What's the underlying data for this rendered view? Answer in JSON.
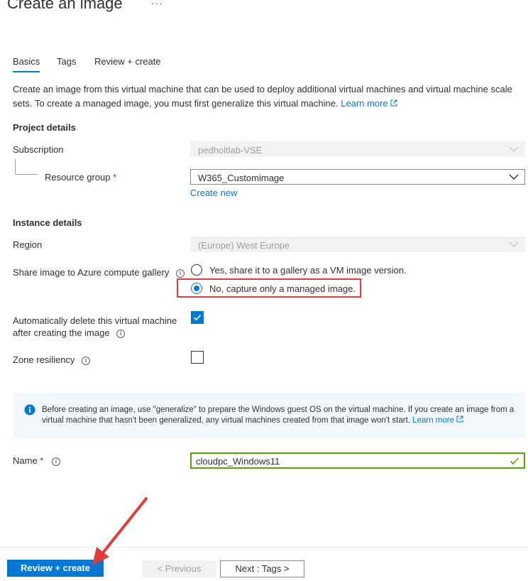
{
  "header": {
    "title": "Create an image",
    "more": "···"
  },
  "tabs": [
    {
      "label": "Basics"
    },
    {
      "label": "Tags"
    },
    {
      "label": "Review + create"
    }
  ],
  "description": {
    "text": "Create an image from this virtual machine that can be used to deploy additional virtual machines and virtual machine scale sets. To create a managed image, you must first generalize this virtual machine.",
    "link": "Learn more"
  },
  "project": {
    "heading": "Project details",
    "subscription": {
      "label": "Subscription",
      "value": "pedholtlab-VSE"
    },
    "resource_group": {
      "label": "Resource group",
      "required": "*",
      "value": "W365_Customimage",
      "create_new": "Create new"
    }
  },
  "instance": {
    "heading": "Instance details",
    "region": {
      "label": "Region",
      "value": "(Europe) West Europe"
    },
    "share": {
      "label": "Share image to Azure compute gallery",
      "options": [
        {
          "label": "Yes, share it to a gallery as a VM image version.",
          "selected": false
        },
        {
          "label": "No, capture only a managed image.",
          "selected": true
        }
      ]
    },
    "auto_delete": {
      "label_line1": "Automatically delete this virtual machine",
      "label_line2": "after creating the image",
      "checked": true
    },
    "zone": {
      "label": "Zone resiliency",
      "checked": false
    }
  },
  "info": {
    "text": "Before creating an image, use \"generalize\" to prepare the Windows guest OS on the virtual machine. If you create an image from a virtual machine that hasn't been generalized, any virtual machines created from that image won't start.",
    "link": "Learn more"
  },
  "name_field": {
    "label": "Name",
    "required": "*",
    "value": "cloudpc_Windows11"
  },
  "footer": {
    "review_create": "Review + create",
    "previous": "< Previous",
    "next": "Next : Tags >"
  },
  "colors": {
    "accent": "#0078d4",
    "highlight": "#e03c3c",
    "valid": "#57a300"
  }
}
